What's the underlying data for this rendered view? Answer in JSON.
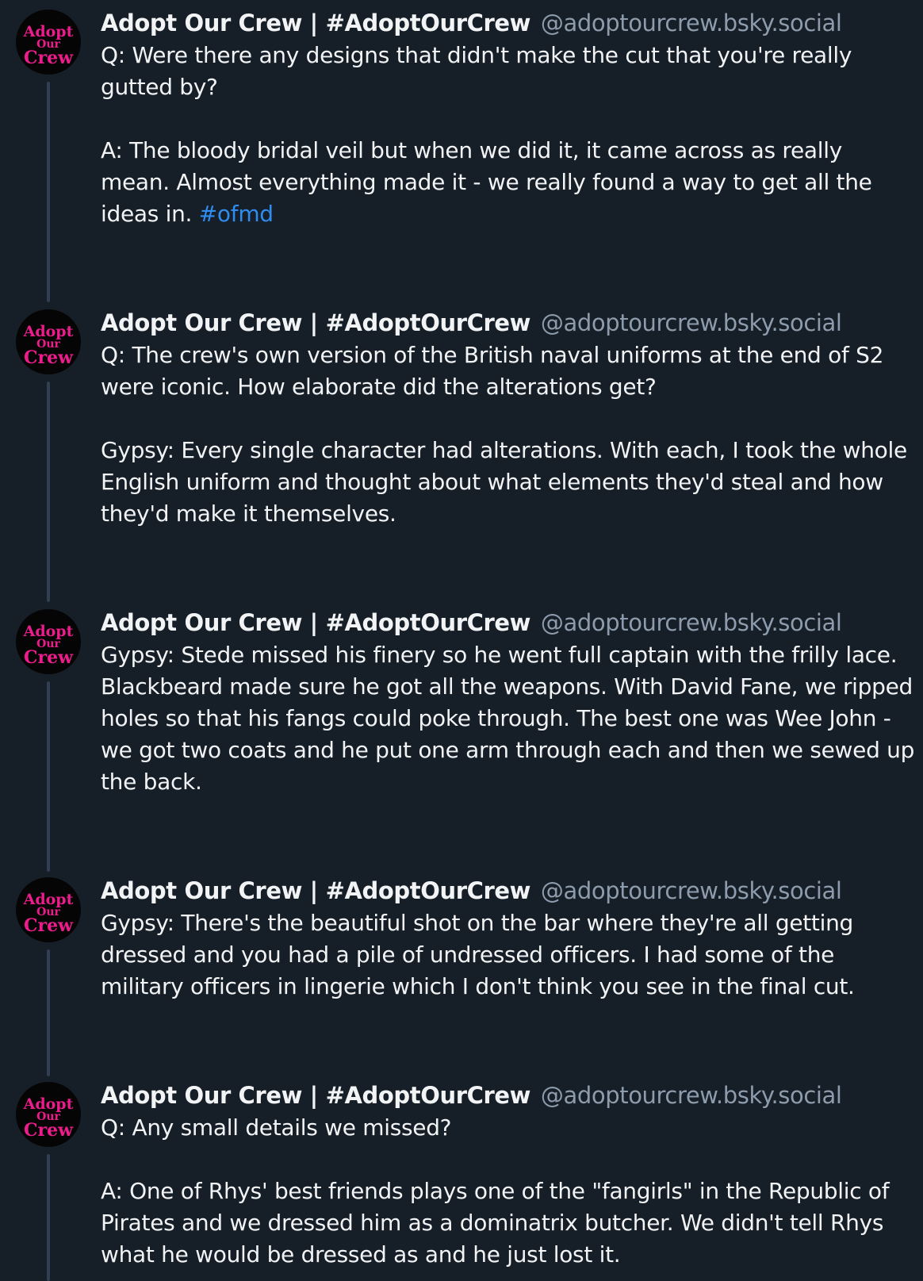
{
  "account": {
    "display_name": "Adopt Our Crew | #AdoptOurCrew",
    "handle": "@adoptourcrew.bsky.social",
    "avatar_text": [
      "Adopt",
      "Our",
      "Crew"
    ],
    "avatar_color": "#ec1c8c"
  },
  "posts": [
    {
      "paragraphs": [
        "Q: Were there any designs that didn't make the cut that you're really gutted by?",
        "A: The bloody bridal veil but when we did it, it came across as really mean. Almost everything made it - we really found a way to get all the ideas in. "
      ],
      "hashtag": "#ofmd"
    },
    {
      "paragraphs": [
        "Q: The crew's own version of the British naval uniforms at the end of S2 were iconic. How elaborate did the alterations get?",
        "Gypsy: Every single character had alterations. With each, I took the whole English uniform and thought about what elements they'd steal and how they'd make it themselves."
      ]
    },
    {
      "paragraphs": [
        "Gypsy: Stede missed his finery so he went full captain with the frilly lace. Blackbeard made sure he got all the weapons. With David Fane, we ripped holes so that his fangs could poke through. The best one was Wee John - we got two coats and he put one arm through each and then we sewed up the back."
      ]
    },
    {
      "paragraphs": [
        "Gypsy: There's the beautiful shot on the bar where they're all getting dressed and you had a pile of undressed officers. I had some of the military officers in lingerie which I don't think you see in the final cut."
      ]
    },
    {
      "paragraphs": [
        "Q: Any small details we missed?",
        "A: One of Rhys' best friends plays one of the \"fangirls\" in the Republic of Pirates and we dressed him as a dominatrix butcher. We didn't tell Rhys what he would be dressed as and he just lost it."
      ]
    }
  ],
  "colors": {
    "background": "#161e27",
    "text": "#f1f3f5",
    "handle": "#8d9cac",
    "hashtag": "#2f8cf0",
    "thread_line": "#2e4052"
  }
}
